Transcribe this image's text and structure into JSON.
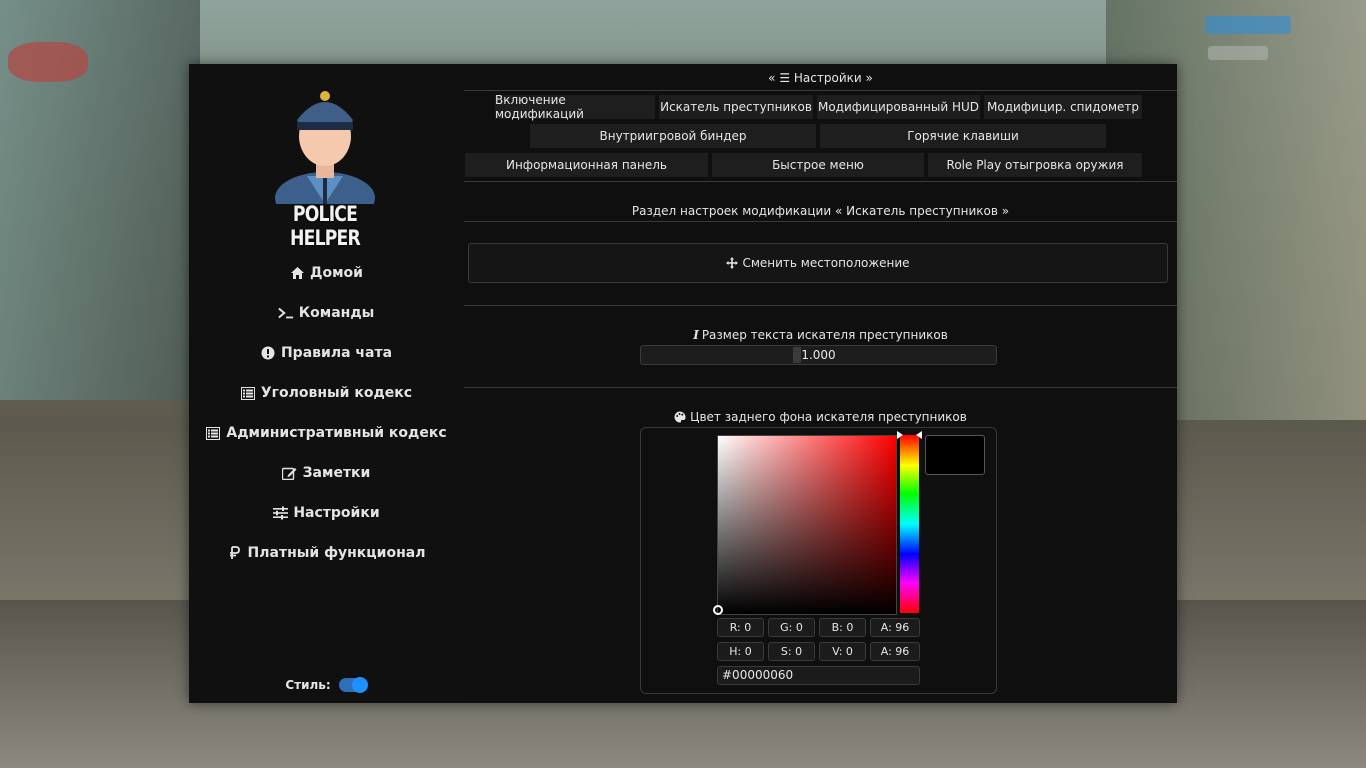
{
  "app": {
    "logo_text": "POLICE HELPER"
  },
  "sidebar": {
    "items": [
      {
        "label": "Домой",
        "icon": "home-icon"
      },
      {
        "label": "Команды",
        "icon": "terminal-icon"
      },
      {
        "label": "Правила чата",
        "icon": "exclamation-circle-icon"
      },
      {
        "label": "Уголовный кодекс",
        "icon": "list-icon"
      },
      {
        "label": "Административный кодекс",
        "icon": "list-icon"
      },
      {
        "label": "Заметки",
        "icon": "edit-icon"
      },
      {
        "label": "Настройки",
        "icon": "sliders-icon"
      },
      {
        "label": "Платный функционал",
        "icon": "ruble-icon"
      }
    ],
    "style_label": "Стиль:",
    "style_toggle_on": true
  },
  "main": {
    "title": "« ☰ Настройки »",
    "tabs_row1": [
      "Включение модификаций",
      "Искатель преступников",
      "Модифицированный HUD",
      "Модифицир. спидометр"
    ],
    "tabs_row2": [
      "Внутриигровой биндер",
      "Горячие клавиши"
    ],
    "tabs_row3": [
      "Информационная панель",
      "Быстрое меню",
      "Role Play отыгровка оружия"
    ],
    "section_title": "Раздел настроек модификации « Искатель преступников »",
    "move_button": "Сменить местоположение",
    "text_size_label": "Размер текста искателя преступников",
    "text_size_value": "1.000",
    "color_label": "Цвет заднего фона искателя преступников",
    "color": {
      "r": "R: 0",
      "g": "G: 0",
      "b": "B: 0",
      "a": "A: 96",
      "h": "H: 0",
      "s": "S: 0",
      "v": "V: 0",
      "a2": "A: 96",
      "hex": "#00000060"
    }
  },
  "colors": {
    "accent": "#1e90ff",
    "panel": "#0f0f0f",
    "tab": "#1e1e1e"
  }
}
